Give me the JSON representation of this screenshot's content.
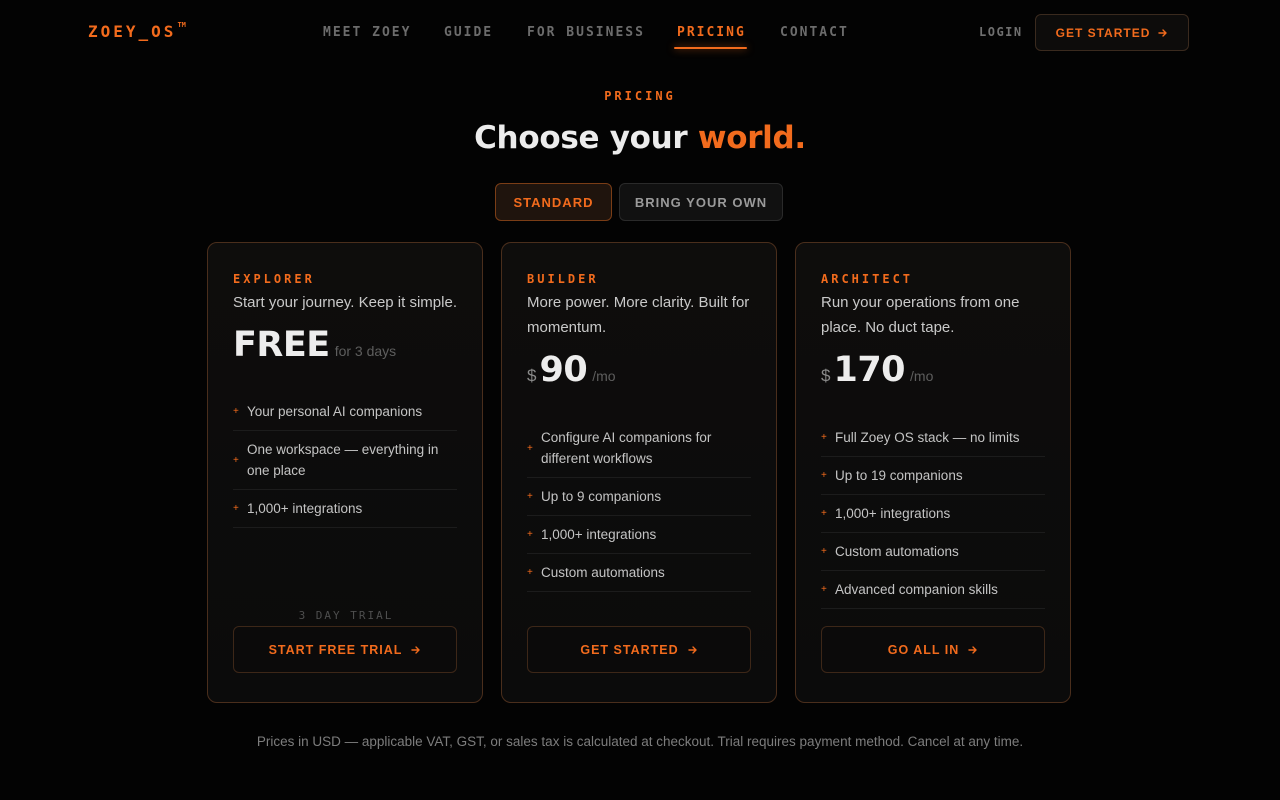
{
  "header": {
    "logo": "ZOEY_OS",
    "logo_mark": "TM",
    "nav": [
      {
        "label": "MEET ZOEY",
        "active": false
      },
      {
        "label": "GUIDE",
        "active": false
      },
      {
        "label": "FOR BUSINESS",
        "active": false
      },
      {
        "label": "PRICING",
        "active": true
      },
      {
        "label": "CONTACT",
        "active": false
      }
    ],
    "login": "LOGIN",
    "cta": "GET STARTED",
    "cta_icon": "arrow-right-icon"
  },
  "hero": {
    "eyebrow": "PRICING",
    "title_main": "Choose your",
    "title_accent": "world."
  },
  "toggle": {
    "options": [
      "STANDARD",
      "BRING YOUR OWN"
    ],
    "selected": "STANDARD"
  },
  "plans": [
    {
      "tier": "EXPLORER",
      "tagline": "Start your journey. Keep it simple.",
      "price": "FREE",
      "price_note": "for 3 days",
      "features": [
        "Your personal AI companions",
        "One workspace — everything in one place",
        "1,000+ integrations"
      ],
      "trial_label": "3 DAY TRIAL",
      "button": "START FREE TRIAL"
    },
    {
      "tier": "BUILDER",
      "tagline": "More power. More clarity. Built for momentum.",
      "currency": "$",
      "price": "90",
      "period": "/mo",
      "features": [
        "Configure AI companions for different workflows",
        "Up to 9 companions",
        "1,000+ integrations",
        "Custom automations"
      ],
      "button": "GET STARTED"
    },
    {
      "tier": "ARCHITECT",
      "tagline": "Run your operations from one place. No duct tape.",
      "currency": "$",
      "price": "170",
      "period": "/mo",
      "features": [
        "Full Zoey OS stack — no limits",
        "Up to 19 companions",
        "1,000+ integrations",
        "Custom automations",
        "Advanced companion skills"
      ],
      "button": "GO ALL IN"
    }
  ],
  "footnote": "Prices in USD — applicable VAT, GST, or sales tax is calculated at checkout. Trial requires payment method. Cancel at any time.",
  "colors": {
    "accent": "#f26b1d",
    "background": "#030303",
    "card_border": "#4a2e1c"
  }
}
